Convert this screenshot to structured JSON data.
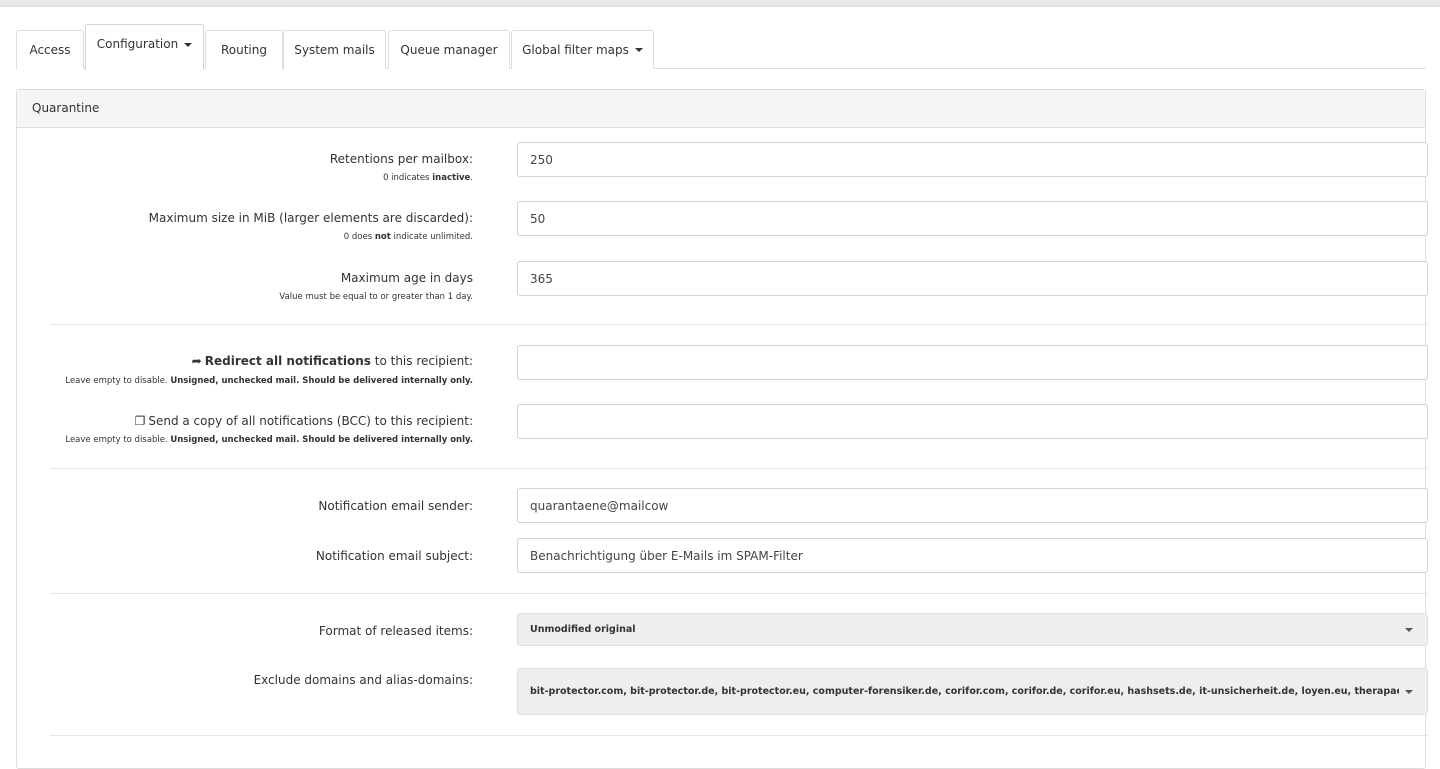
{
  "tabs": [
    {
      "label": "Access"
    },
    {
      "label": "Configuration",
      "active": true,
      "dropdown": true
    },
    {
      "label": "Routing"
    },
    {
      "label": "System mails"
    },
    {
      "label": "Queue manager"
    },
    {
      "label": "Global filter maps",
      "dropdown": true
    }
  ],
  "panel": {
    "title": "Quarantine"
  },
  "fields": {
    "retentions": {
      "label": "Retentions per mailbox:",
      "help_pre": "0 indicates ",
      "help_bold": "inactive",
      "help_post": ".",
      "value": "250"
    },
    "max_size": {
      "label": "Maximum size in MiB (larger elements are discarded):",
      "help_pre": "0 does ",
      "help_bold": "not",
      "help_post": " indicate unlimited.",
      "value": "50"
    },
    "max_age": {
      "label": "Maximum age in days",
      "help": "Value must be equal to or greater than 1 day.",
      "value": "365"
    },
    "redirect": {
      "icon": "share-arrow-icon",
      "label_bold": "Redirect all notifications",
      "label_post": " to this recipient:",
      "help_pre": "Leave empty to disable. ",
      "help_bold": "Unsigned, unchecked mail. Should be delivered internally only.",
      "value": ""
    },
    "bcc": {
      "icon": "copy-icon",
      "label": "Send a copy of all notifications (BCC) to this recipient:",
      "help_pre": "Leave empty to disable. ",
      "help_bold": "Unsigned, unchecked mail. Should be delivered internally only.",
      "value": ""
    },
    "sender": {
      "label": "Notification email sender:",
      "value": "quarantaene@mailcow"
    },
    "subject": {
      "label": "Notification email subject:",
      "value": "Benachrichtigung über E-Mails im SPAM-Filter"
    },
    "format": {
      "label": "Format of released items:",
      "selected": "Unmodified original"
    },
    "exclude": {
      "label": "Exclude domains and alias-domains:",
      "selected": "bit-protector.com, bit-protector.de, bit-protector.eu, computer-forensiker.de, corifor.com, corifor.de, corifor.eu, hashsets.de, it-unsicherheit.de, loyen.eu, therapaedmedico.de, therapa"
    }
  },
  "colors": {
    "panel_header_bg": "#f5f5f5",
    "border": "#dddddd",
    "select_bg": "#eeeeee"
  }
}
